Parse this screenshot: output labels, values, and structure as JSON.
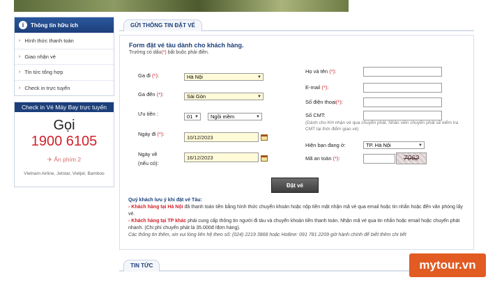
{
  "sidebar": {
    "title": "Thông tin hữu ích",
    "items": [
      {
        "label": "Hình thức thanh toán"
      },
      {
        "label": "Giao nhận vé"
      },
      {
        "label": "Tin tức tổng hợp"
      },
      {
        "label": "Check in trực tuyến"
      }
    ],
    "checkin": {
      "title": "Check in Vé Máy Bay trực tuyến",
      "call_label": "Gọi",
      "phone": "1900 6105",
      "extension": "✈ Ấn phím 2",
      "airlines": "Vietnam Airline, Jetstar, Vietjet, Bamboo"
    }
  },
  "main_tab": "GỬI THÔNG TIN ĐẶT VÉ",
  "form": {
    "title": "Form đặt vé tàu dành cho khách hàng.",
    "note_prefix": "Trường có dấu",
    "note_star": "(*)",
    "note_suffix": "bắt buộc phải điền.",
    "from_label": "Ga đi",
    "from_value": "Hà Nội",
    "to_label": "Ga đến",
    "to_value": "Sài Gòn",
    "priority_label": "Ưu tiên :",
    "priority_qty": "01",
    "priority_type": "Ngồi mềm",
    "depart_label": "Ngày đi",
    "depart_value": "10/12/2023",
    "return_label": "Ngày về",
    "return_sub": "(nếu có):",
    "return_value": "16/12/2023",
    "name_label": "Họ và tên",
    "email_label": "E-mail",
    "phone_label": "Số điện thoại",
    "id_label": "Số CMT:",
    "id_note": "(Dành cho KH nhận vé qua chuyển phát. Nhân viên chuyển phát sẽ kiểm tra CMT tại thời điểm giao vé)",
    "location_label": "Hiện bạn đang ở:",
    "location_value": "TP. Hà Nội",
    "captcha_label": "Mã an toàn",
    "captcha_value": "7062",
    "submit_label": "Đặt vé",
    "star": "(*)",
    "colon": ":"
  },
  "notes": {
    "title": "Quý khách lưu ý khi đặt vé Tàu:",
    "hn_prefix": "- ",
    "hn_label": "Khách hàng tại Hà Nội",
    "hn_text": " đã thanh toán tiền bằng hình thức chuyển khoản hoặc nộp tiền mặt nhận mã vé qua email hoặc tin nhắn hoặc đến văn phòng lấy vé.",
    "hcm_prefix": "- ",
    "hcm_label": "Khách hàng tại TP khác",
    "hcm_text": " phải cung cấp thông tin người đi tàu và chuyển khoản tiền thanh toán. Nhận mã vé qua tin nhắn hoặc email hoặc chuyển phát nhanh. (Chi phí chuyển phát là 35.000đ /đơn hàng).",
    "contact": "Các thông tin thêm, xin vui lòng liên hệ theo số: (024) 2219 3868 hoặc Hotline: 091 781 2209 giờ hành chính để biết thêm chi tiết"
  },
  "news_tab": "TIN TỨC",
  "watermark": "mytour.vn",
  "colors": {
    "brand_blue": "#1c3f7a",
    "required_red": "#d0212a",
    "select_yellow": "#fffbd8",
    "watermark_orange": "#e15b22"
  }
}
